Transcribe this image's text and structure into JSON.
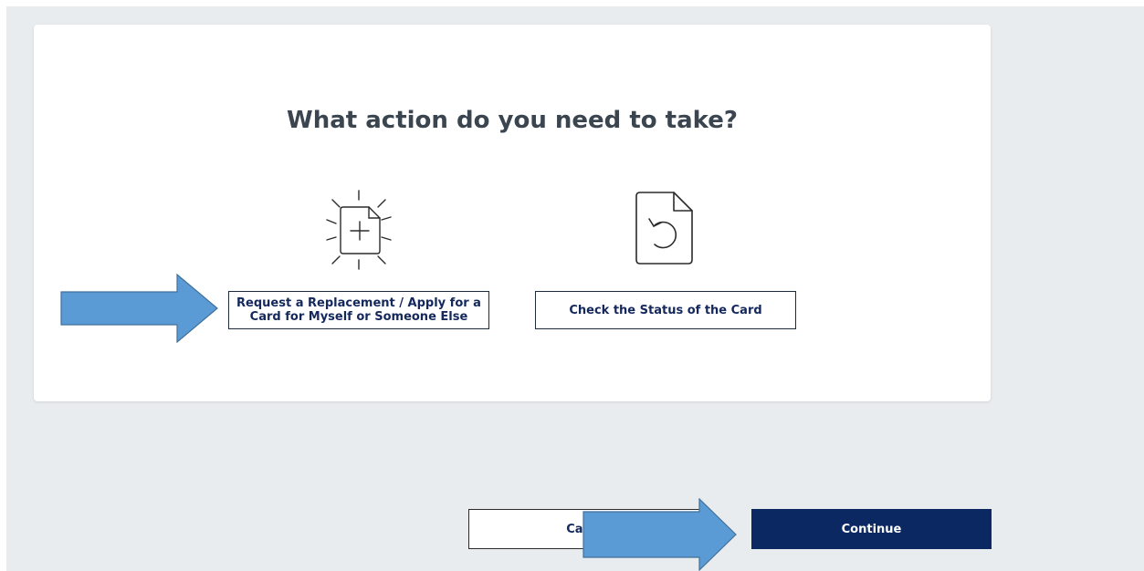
{
  "page": {
    "title": "What action do you need to take?"
  },
  "options": [
    {
      "icon": "new-document-icon",
      "label": "Request a Replacement / Apply for a Card for Myself or Someone Else"
    },
    {
      "icon": "document-refresh-icon",
      "label": "Check the Status of the Card"
    }
  ],
  "footer": {
    "cancel_label": "Cancel",
    "continue_label": "Continue"
  },
  "colors": {
    "background": "#e9ecef",
    "primary_button": "#0b2862",
    "button_text": "#14285c",
    "annotation_arrow": "#5b9bd5"
  }
}
